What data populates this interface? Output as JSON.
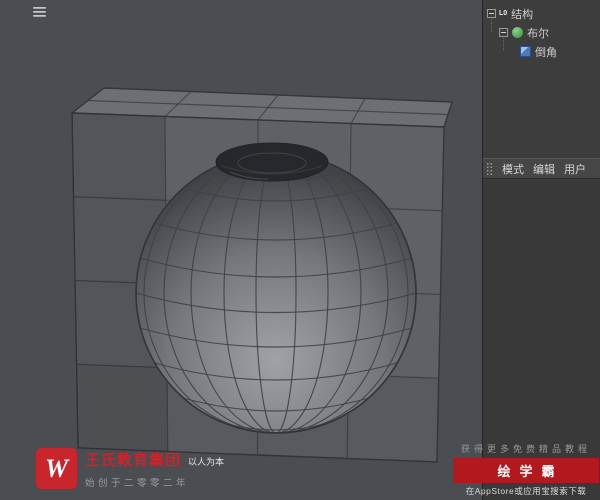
{
  "colors": {
    "viewport_bg": "#4a4d52",
    "cube_top": "#6c6f74",
    "cube_front": "#5e6166",
    "wire": "#3f4145",
    "panel_bg": "#3c3c3c",
    "panel_lower": "#393939",
    "tabbar_bg": "#464646",
    "promo_red": "#b2181d",
    "brand_red": "#c8252c"
  },
  "object_manager": {
    "header_label": "结构",
    "header_badge": "L0",
    "items": [
      {
        "label": "布尔",
        "icon": "boolean-sphere-green-icon"
      },
      {
        "label": "倒角",
        "icon": "bevel-cube-blue-icon"
      }
    ]
  },
  "tabs": [
    "模式",
    "编辑",
    "用户"
  ],
  "branding": {
    "company": "王氏教育集团",
    "slogan": "以人为本",
    "founded": "始创于二零零二年",
    "logo_letter": "W"
  },
  "promo": {
    "line1": "获得更多免费精品教程",
    "app_name": "绘学霸",
    "line2": "在AppStore或应用宝搜索下载"
  },
  "icons": {
    "viewport_menu": "hamburger-lines",
    "tree_expander": "minus-box",
    "dock_grip": "dot-grid"
  }
}
